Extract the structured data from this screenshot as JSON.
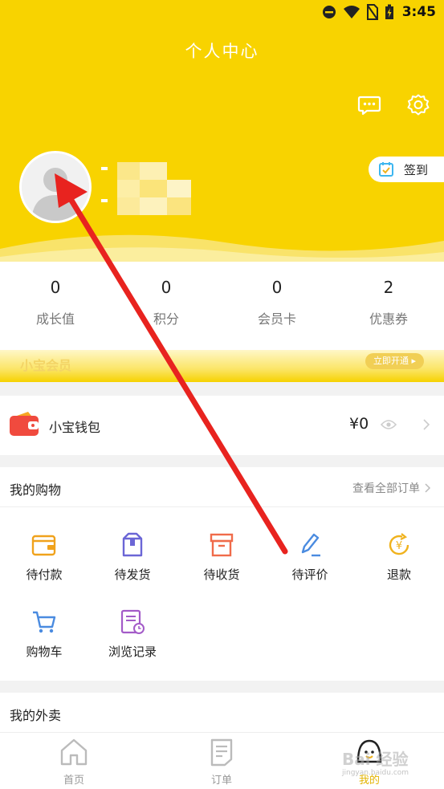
{
  "status_bar": {
    "time": "3:45"
  },
  "header": {
    "title": "个人中心",
    "sign_in_label": "签到",
    "icons": [
      "message-icon",
      "settings-icon",
      "calendar-check-icon"
    ]
  },
  "stats": [
    {
      "value": "0",
      "label": "成长值"
    },
    {
      "value": "0",
      "label": "积分"
    },
    {
      "value": "0",
      "label": "会员卡"
    },
    {
      "value": "2",
      "label": "优惠券"
    }
  ],
  "membership": {
    "title": "小宝会员",
    "action": "立即开通 ▸"
  },
  "wallet": {
    "label": "小宝钱包",
    "amount": "¥0"
  },
  "shopping": {
    "title": "我的购物",
    "view_all": "查看全部订单",
    "items": [
      {
        "label": "待付款",
        "icon": "wallet-icon",
        "color": "#f0a21c"
      },
      {
        "label": "待发货",
        "icon": "box-icon",
        "color": "#6b66d6"
      },
      {
        "label": "待收货",
        "icon": "delivery-box-icon",
        "color": "#f06b4a"
      },
      {
        "label": "待评价",
        "icon": "pen-icon",
        "color": "#4a8be0"
      },
      {
        "label": "退款",
        "icon": "refund-icon",
        "color": "#f0b21c"
      },
      {
        "label": "购物车",
        "icon": "cart-icon",
        "color": "#4a8be0"
      },
      {
        "label": "浏览记录",
        "icon": "history-icon",
        "color": "#a35bc8"
      }
    ]
  },
  "takeaway": {
    "title": "我的外卖"
  },
  "bottom_nav": [
    {
      "label": "首页",
      "icon": "home-icon",
      "active": false
    },
    {
      "label": "订单",
      "icon": "order-icon",
      "active": false
    },
    {
      "label": "我的",
      "icon": "profile-icon",
      "active": true
    }
  ],
  "watermark": {
    "text": "Bai 经验",
    "sub": "jingyan.baidu.com"
  },
  "colors": {
    "brand_yellow": "#f8d300",
    "active_nav": "#e3b300",
    "annotation_red": "#e8231f"
  }
}
